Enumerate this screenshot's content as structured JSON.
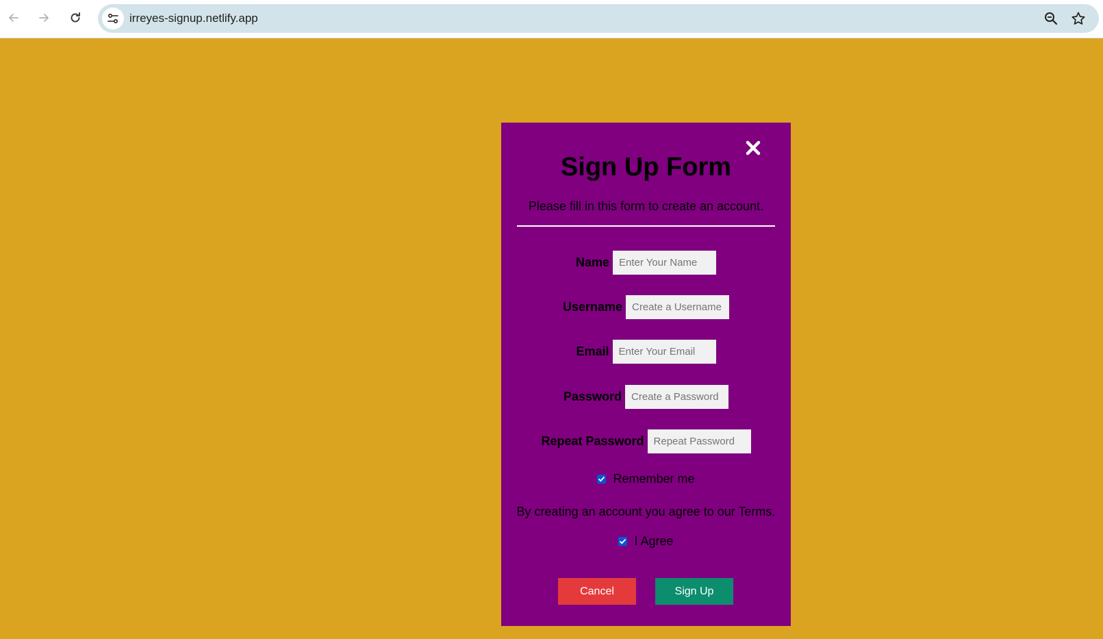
{
  "browser": {
    "url": "irreyes-signup.netlify.app"
  },
  "colors": {
    "page_background": "#dba420",
    "card_background": "#800080",
    "cancel_button": "#e53a3c",
    "signup_button": "#0c8d6e",
    "checkbox_accent": "#0b57d0"
  },
  "form": {
    "title": "Sign Up Form",
    "subtitle": "Please fill in this form to create an account.",
    "close_icon": "close-icon",
    "fields": {
      "name": {
        "label": "Name",
        "placeholder": "Enter Your Name",
        "value": ""
      },
      "username": {
        "label": "Username",
        "placeholder": "Create a Username",
        "value": ""
      },
      "email": {
        "label": "Email",
        "placeholder": "Enter Your Email",
        "value": ""
      },
      "password": {
        "label": "Password",
        "placeholder": "Create a Password",
        "value": ""
      },
      "repeat_password": {
        "label": "Repeat Password",
        "placeholder": "Repeat Password",
        "value": ""
      }
    },
    "remember": {
      "label": "Remember me",
      "checked": true
    },
    "terms_text": "By creating an account you agree to our Terms.",
    "agree": {
      "label": "I Agree",
      "checked": true
    },
    "cancel_label": "Cancel",
    "signup_label": "Sign Up"
  }
}
